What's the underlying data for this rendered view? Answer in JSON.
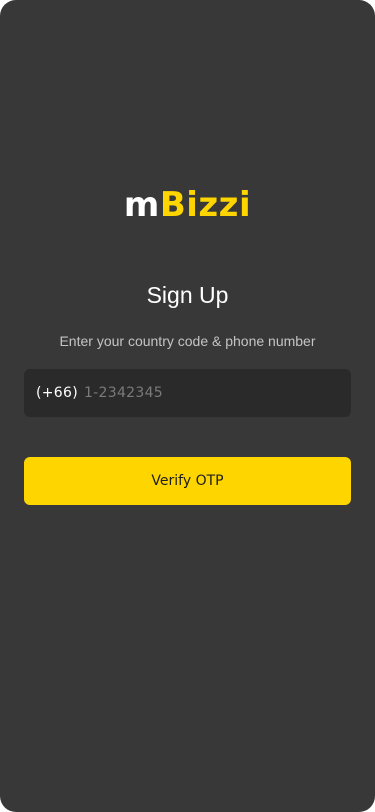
{
  "brand": {
    "logo_prefix": "m",
    "logo_suffix": "Bizzi",
    "colors": {
      "accent": "#FFD500",
      "background": "#383838",
      "input_background": "#2a2a2a"
    }
  },
  "signup": {
    "title": "Sign Up",
    "subtitle": "Enter your country code & phone number",
    "country_code": "(+66)",
    "phone_value": "",
    "phone_placeholder": "1-2342345",
    "verify_label": "Verify OTP"
  }
}
